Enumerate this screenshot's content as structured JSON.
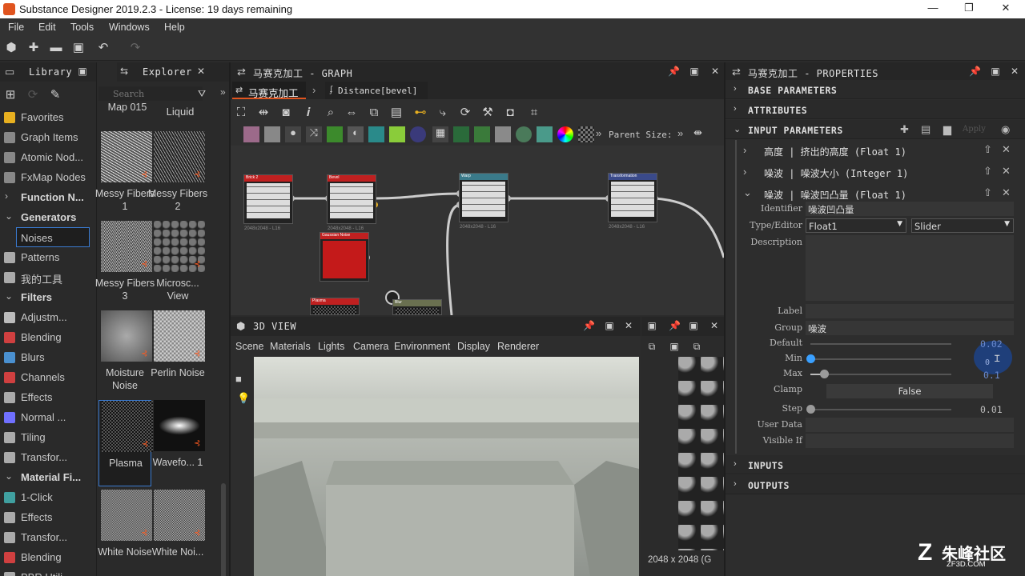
{
  "titlebar": {
    "title": "Substance Designer 2019.2.3 - License: 19 days remaining",
    "min": "—",
    "max": "❐",
    "close": "✕"
  },
  "menu": [
    "File",
    "Edit",
    "Tools",
    "Windows",
    "Help"
  ],
  "library": {
    "title": "Library",
    "items": [
      {
        "label": "Favorites",
        "kind": "item",
        "color": "#e8b020"
      },
      {
        "label": "Graph Items",
        "kind": "item",
        "color": "#888"
      },
      {
        "label": "Atomic Nod...",
        "kind": "item",
        "color": "#888"
      },
      {
        "label": "FxMap Nodes",
        "kind": "item",
        "color": "#888"
      },
      {
        "label": "Function N...",
        "kind": "group",
        "chev": "›"
      },
      {
        "label": "Generators",
        "kind": "group",
        "chev": "⌄"
      },
      {
        "label": "Noises",
        "kind": "item",
        "color": "#aaa"
      },
      {
        "label": "Patterns",
        "kind": "item",
        "color": "#aaa"
      },
      {
        "label": "我的工具",
        "kind": "item",
        "color": "#aaa"
      },
      {
        "label": "Filters",
        "kind": "group",
        "chev": "⌄"
      },
      {
        "label": "Adjustm...",
        "kind": "item",
        "color": "#bbb"
      },
      {
        "label": "Blending",
        "kind": "item",
        "color": "#d04040"
      },
      {
        "label": "Blurs",
        "kind": "item",
        "color": "#4a90d0"
      },
      {
        "label": "Channels",
        "kind": "item",
        "color": "#d04040"
      },
      {
        "label": "Effects",
        "kind": "item",
        "color": "#aaa"
      },
      {
        "label": "Normal ...",
        "kind": "item",
        "color": "#7070ff"
      },
      {
        "label": "Tiling",
        "kind": "item",
        "color": "#aaa"
      },
      {
        "label": "Transfor...",
        "kind": "item",
        "color": "#aaa"
      },
      {
        "label": "Material Fi...",
        "kind": "group",
        "chev": "⌄"
      },
      {
        "label": "1-Click",
        "kind": "item",
        "color": "#40a0a0"
      },
      {
        "label": "Effects",
        "kind": "item",
        "color": "#aaa"
      },
      {
        "label": "Transfor...",
        "kind": "item",
        "color": "#aaa"
      },
      {
        "label": "Blending",
        "kind": "item",
        "color": "#d04040"
      },
      {
        "label": "PBR Utili...",
        "kind": "item",
        "color": "#aaa"
      }
    ]
  },
  "explorer": {
    "title": "Explorer",
    "search_placeholder": "Search",
    "top_captions": [
      "Map 015",
      "Liquid"
    ],
    "thumbs": [
      {
        "label": "Messy Fibers 1"
      },
      {
        "label": "Messy Fibers 2"
      },
      {
        "label": "Messy Fibers 3"
      },
      {
        "label": "Microsc... View"
      },
      {
        "label": "Moisture Noise"
      },
      {
        "label": "Perlin Noise"
      },
      {
        "label": "Plasma"
      },
      {
        "label": "Wavefo... 1"
      },
      {
        "label": "White Noise"
      },
      {
        "label": "White Noi..."
      }
    ]
  },
  "graph": {
    "title": "马赛克加工 - GRAPH",
    "tab": "马赛克加工",
    "breadcrumb": "Distance[bevel]",
    "parent_size": "Parent Size:",
    "nodes": [
      {
        "title": "Brick 2",
        "color": "#c02020",
        "size": "2048x2048 - L16"
      },
      {
        "title": "Bevel",
        "color": "#c02020",
        "size": "2048x2048 - L16"
      },
      {
        "title": "Warp",
        "color": "#3a7a8a",
        "size": "2048x2048 - L16"
      },
      {
        "title": "Transformation",
        "color": "#3a4a8a",
        "size": "2048x2048 - L16"
      },
      {
        "title": "Gaussian Noise",
        "color": "#c02020",
        "size": ""
      },
      {
        "title": "Plasma",
        "color": "#c02020",
        "size": ""
      },
      {
        "title": "Blur",
        "color": "#6a7050",
        "size": ""
      }
    ]
  },
  "view3d": {
    "title": "3D VIEW",
    "menu": [
      "Scene",
      "Materials",
      "Lights",
      "Camera",
      "Environment",
      "Display",
      "Renderer"
    ]
  },
  "view2d": {
    "status": "2048 x 2048 (G"
  },
  "props": {
    "title": "马赛克加工 - PROPERTIES",
    "sections": [
      "BASE PARAMETERS",
      "ATTRIBUTES",
      "INPUT PARAMETERS"
    ],
    "apply": "Apply",
    "params": [
      "高度 | 挤出的高度 (Float 1)",
      "噪波 | 噪波大小 (Integer 1)",
      "噪波 | 噪波凹凸量 (Float 1)"
    ],
    "fields": {
      "identifier_label": "Identifier",
      "identifier": "噪波凹凸量",
      "type_label": "Type/Editor",
      "type": "Float1",
      "editor": "Slider",
      "description_label": "Description",
      "label_label": "Label",
      "group_label": "Group",
      "group": "噪波",
      "default_label": "Default",
      "default": "0.02",
      "min_label": "Min",
      "min": "0",
      "max_label": "Max",
      "max": "0.1",
      "clamp_label": "Clamp",
      "clamp": "False",
      "step_label": "Step",
      "step": "0.01",
      "userdata_label": "User Data",
      "visibleif_label": "Visible If"
    },
    "bottom_sections": [
      "INPUTS",
      "OUTPUTS"
    ]
  },
  "watermark": {
    "text": "朱峰社区",
    "sub": "ZF3D.COM"
  }
}
